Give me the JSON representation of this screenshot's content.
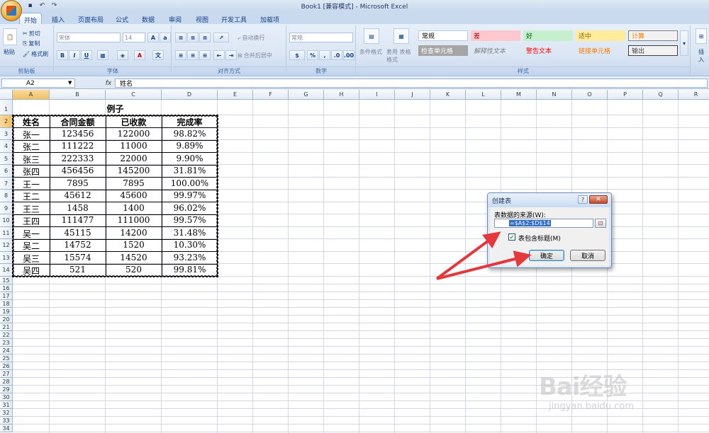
{
  "window": {
    "title": "Book1  [兼容模式] - Microsoft Excel"
  },
  "tabs": [
    "开始",
    "插入",
    "页面布局",
    "公式",
    "数据",
    "审阅",
    "视图",
    "开发工具",
    "加载项"
  ],
  "active_tab": "开始",
  "ribbon": {
    "clipboard": {
      "label": "剪贴板",
      "paste": "粘贴",
      "cut": "剪切",
      "copy": "复制",
      "format_painter": "格式刷"
    },
    "font": {
      "label": "字体",
      "font_name": "宋体",
      "font_size": "14",
      "bold": "B",
      "italic": "I",
      "underline": "U"
    },
    "alignment": {
      "label": "对齐方式",
      "wrap": "自动换行",
      "merge": "合并后居中"
    },
    "number": {
      "label": "数字",
      "format": "常规",
      "percent": "%",
      "comma": ","
    },
    "styles": {
      "label": "样式",
      "cond_format": "条件格式",
      "table_format": "套用 表格格式",
      "cells": [
        {
          "text": "常规",
          "color": "#000000"
        },
        {
          "text": "差",
          "color": "#9c0006"
        },
        {
          "text": "好",
          "color": "#006100"
        },
        {
          "text": "适中",
          "color": "#9c6500"
        },
        {
          "text": "计算",
          "color": "#fa7d00"
        },
        {
          "text": "检查单元格",
          "color": "#ffffff"
        },
        {
          "text": "解释性文本",
          "color": "#7f7f7f"
        },
        {
          "text": "警告文本",
          "color": "#ff0000"
        },
        {
          "text": "链接单元格",
          "color": "#fa7d00"
        },
        {
          "text": "输出",
          "color": "#3f3f3f"
        }
      ]
    },
    "cells_group": {
      "insert": "插入"
    }
  },
  "formula_bar": {
    "name_box": "A2",
    "fx": "fx",
    "value": "姓名"
  },
  "columns": [
    "A",
    "B",
    "C",
    "D",
    "E",
    "F",
    "G",
    "H",
    "I",
    "J",
    "K",
    "L",
    "M",
    "N",
    "O",
    "P",
    "Q",
    "R"
  ],
  "rows": [
    "1",
    "2",
    "3",
    "4",
    "5",
    "6",
    "7",
    "8",
    "9",
    "10",
    "11",
    "12",
    "13",
    "14",
    "15",
    "16",
    "17",
    "18",
    "19",
    "20",
    "21",
    "22",
    "23",
    "24",
    "25",
    "26",
    "27",
    "28",
    "29",
    "30",
    "31",
    "32",
    "33",
    "34"
  ],
  "table": {
    "title": "例子",
    "headers": [
      "姓名",
      "合同金额",
      "已收款",
      "完成率"
    ],
    "rows": [
      [
        "张一",
        "123456",
        "122000",
        "98.82%"
      ],
      [
        "张二",
        "111222",
        "11000",
        "9.89%"
      ],
      [
        "张三",
        "222333",
        "22000",
        "9.90%"
      ],
      [
        "张四",
        "456456",
        "145200",
        "31.81%"
      ],
      [
        "王一",
        "7895",
        "7895",
        "100.00%"
      ],
      [
        "王二",
        "45612",
        "45600",
        "99.97%"
      ],
      [
        "王三",
        "1458",
        "1400",
        "96.02%"
      ],
      [
        "王四",
        "111477",
        "111000",
        "99.57%"
      ],
      [
        "吴一",
        "45115",
        "14200",
        "31.48%"
      ],
      [
        "吴二",
        "14752",
        "1520",
        "10.30%"
      ],
      [
        "吴三",
        "15574",
        "14520",
        "93.23%"
      ],
      [
        "吴四",
        "521",
        "520",
        "99.81%"
      ]
    ]
  },
  "dialog": {
    "title": "创建表",
    "help": "?",
    "close": "✕",
    "source_label": "表数据的来源(W):",
    "range": "=$A$2:$D$14",
    "has_headers": "表包含标题(M)",
    "ok": "确定",
    "cancel": "取消"
  },
  "watermark": {
    "brand": "Bai经验",
    "url": "jingyan.baidu.com"
  }
}
